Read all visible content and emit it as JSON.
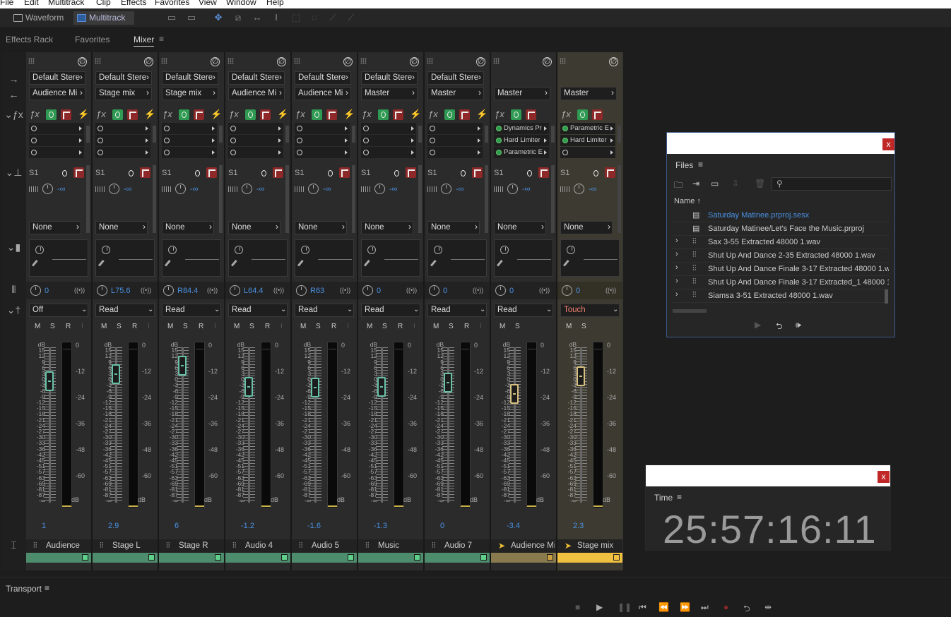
{
  "menu": [
    "File",
    "Edit",
    "Multitrack",
    "Clip",
    "Effects",
    "Favorites",
    "View",
    "Window",
    "Help"
  ],
  "toolbar": {
    "waveform": "Waveform",
    "multitrack": "Multitrack"
  },
  "tabs": [
    "Effects Rack",
    "Favorites",
    "Mixer"
  ],
  "mixer": {
    "channels": [
      {
        "input": "Default Stere",
        "output": "Audience Mi",
        "send": "None",
        "pan": "0",
        "mode": "Off",
        "vol": "1",
        "name": "Audience",
        "fx": [
          "",
          "",
          ""
        ],
        "sendlevel": "-∞",
        "cap_db": 0.5
      },
      {
        "input": "Default Stere",
        "output": "Stage mix",
        "send": "None",
        "pan": "L75.6",
        "mode": "Read",
        "vol": "2.9",
        "name": "Stage L",
        "fx": [
          "",
          "",
          ""
        ],
        "sendlevel": "-∞",
        "cap_db": 3
      },
      {
        "input": "Default Stere",
        "output": "Stage mix",
        "send": "None",
        "pan": "R84.4",
        "mode": "Read",
        "vol": "6",
        "name": "Stage R",
        "fx": [
          "",
          "",
          ""
        ],
        "sendlevel": "-∞",
        "cap_db": 6
      },
      {
        "input": "Default Stere",
        "output": "Audience Mi",
        "send": "None",
        "pan": "L64.4",
        "mode": "Read",
        "vol": "-1.2",
        "name": "Audio 4",
        "fx": [
          "",
          "",
          ""
        ],
        "sendlevel": "-∞",
        "cap_db": -1.2
      },
      {
        "input": "Default Stere",
        "output": "Audience Mi",
        "send": "None",
        "pan": "R63",
        "mode": "Read",
        "vol": "-1.6",
        "name": "Audio 5",
        "fx": [
          "",
          "",
          ""
        ],
        "sendlevel": "-∞",
        "cap_db": -1.6
      },
      {
        "input": "Default Stere",
        "output": "Master",
        "send": "None",
        "pan": "0",
        "mode": "Read",
        "vol": "-1.3",
        "name": "Music",
        "fx": [
          "",
          "",
          ""
        ],
        "sendlevel": "-∞",
        "cap_db": -1.3
      },
      {
        "input": "Default Stere",
        "output": "Master",
        "send": "None",
        "pan": "0",
        "mode": "Read",
        "vol": "0",
        "name": "Audio 7",
        "fx": [
          "",
          "",
          ""
        ],
        "sendlevel": "-∞",
        "cap_db": 0
      },
      {
        "input": "",
        "output": "Master",
        "send": "None",
        "pan": "0",
        "mode": "Read",
        "vol": "-3.4",
        "name": "Audience Mi",
        "fx": [
          "Dynamics Pr",
          "Hard Limiter",
          "Parametric E"
        ],
        "sendlevel": "-∞",
        "cap_db": -3.4
      },
      {
        "input": "",
        "output": "Master",
        "send": "None",
        "pan": "0",
        "mode": "Touch",
        "vol": "2.3",
        "name": "Stage mix",
        "fx": [
          "Parametric E",
          "Hard Limiter",
          ""
        ],
        "sendlevel": "-∞",
        "cap_db": 2.3
      }
    ],
    "left_scale": [
      "dB",
      "15",
      "12",
      "9",
      "6",
      "3",
      "0",
      "-3",
      "-6",
      "-9",
      "-12",
      "-15",
      "-18",
      "-21",
      "-24",
      "-27",
      "-30",
      "-33",
      "-36",
      "-42",
      "-45",
      "-51",
      "-57",
      "-63",
      "-69",
      "-81",
      "-87",
      "-∞"
    ],
    "right_scale": [
      "0",
      "-12",
      "-24",
      "-36",
      "-48",
      "-60",
      "dB"
    ],
    "msr": [
      "M",
      "S",
      "R",
      "I"
    ]
  },
  "files": {
    "title": "Files",
    "col": "Name",
    "items": [
      "Saturday Matinee.prproj.sesx",
      "Saturday Matinee/Let's Face the Music.prproj",
      "Sax 3-55 Extracted 48000 1.wav",
      "Shut Up And Dance 2-35 Extracted 48000 1.wav",
      "Shut Up And Dance Finale 3-17 Extracted 48000 1.wav",
      "Shut Up And Dance Finale 3-17 Extracted_1 48000 1.wav",
      "Siamsa 3-51 Extracted 48000 1.wav"
    ]
  },
  "time": {
    "title": "Time",
    "value": "25:57:16:11"
  },
  "transport": {
    "title": "Transport"
  },
  "close": "x"
}
